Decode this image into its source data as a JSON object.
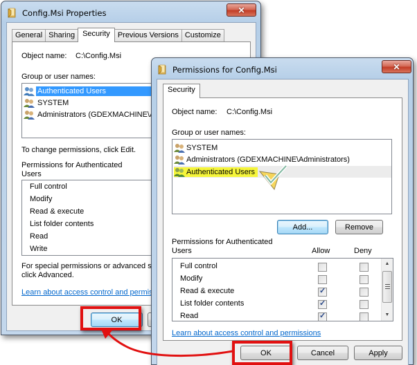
{
  "properties_window": {
    "title": "Config.Msi Properties",
    "close_icon": "close-icon",
    "tabs": [
      {
        "label": "General",
        "active": false
      },
      {
        "label": "Sharing",
        "active": false
      },
      {
        "label": "Security",
        "active": true
      },
      {
        "label": "Previous Versions",
        "active": false
      },
      {
        "label": "Customize",
        "active": false
      }
    ],
    "object_name_label": "Object name:",
    "object_name_value": "C:\\Config.Msi",
    "group_label": "Group or user names:",
    "users": [
      {
        "name": "Authenticated Users",
        "selected": true
      },
      {
        "name": "SYSTEM",
        "selected": false
      },
      {
        "name": "Administrators (GDEXMACHINE\\Administrators)",
        "selected": false
      }
    ],
    "change_hint": "To change permissions, click Edit.",
    "permissions_label_line1": "Permissions for Authenticated",
    "permissions_label_line2": "Users",
    "permissions": [
      "Full control",
      "Modify",
      "Read & execute",
      "List folder contents",
      "Read",
      "Write"
    ],
    "advanced_hint_line1": "For special permissions or advanced settings,",
    "advanced_hint_line2": "click Advanced.",
    "learn_link": "Learn about access control and permissions",
    "ok_label": "OK"
  },
  "permissions_window": {
    "title": "Permissions for Config.Msi",
    "close_icon": "close-icon",
    "tab_label": "Security",
    "object_name_label": "Object name:",
    "object_name_value": "C:\\Config.Msi",
    "group_label": "Group or user names:",
    "users": [
      {
        "name": "SYSTEM",
        "highlighted": false
      },
      {
        "name": "Administrators (GDEXMACHINE\\Administrators)",
        "highlighted": false
      },
      {
        "name": "Authenticated Users",
        "highlighted": true
      }
    ],
    "add_label": "Add...",
    "remove_label": "Remove",
    "permissions_label_line1": "Permissions for Authenticated",
    "permissions_label_line2": "Users",
    "allow_header": "Allow",
    "deny_header": "Deny",
    "permissions": [
      {
        "name": "Full control",
        "allow": false,
        "deny": false
      },
      {
        "name": "Modify",
        "allow": false,
        "deny": false
      },
      {
        "name": "Read & execute",
        "allow": true,
        "deny": false
      },
      {
        "name": "List folder contents",
        "allow": true,
        "deny": false
      },
      {
        "name": "Read",
        "allow": true,
        "deny": false
      }
    ],
    "learn_link": "Learn about access control and permissions",
    "ok_label": "OK",
    "cancel_label": "Cancel",
    "apply_label": "Apply"
  },
  "annotation": {
    "highlight_color": "#e11010",
    "arrow_color": "#e11010",
    "checkmark": "checkmark-callout-icon"
  }
}
